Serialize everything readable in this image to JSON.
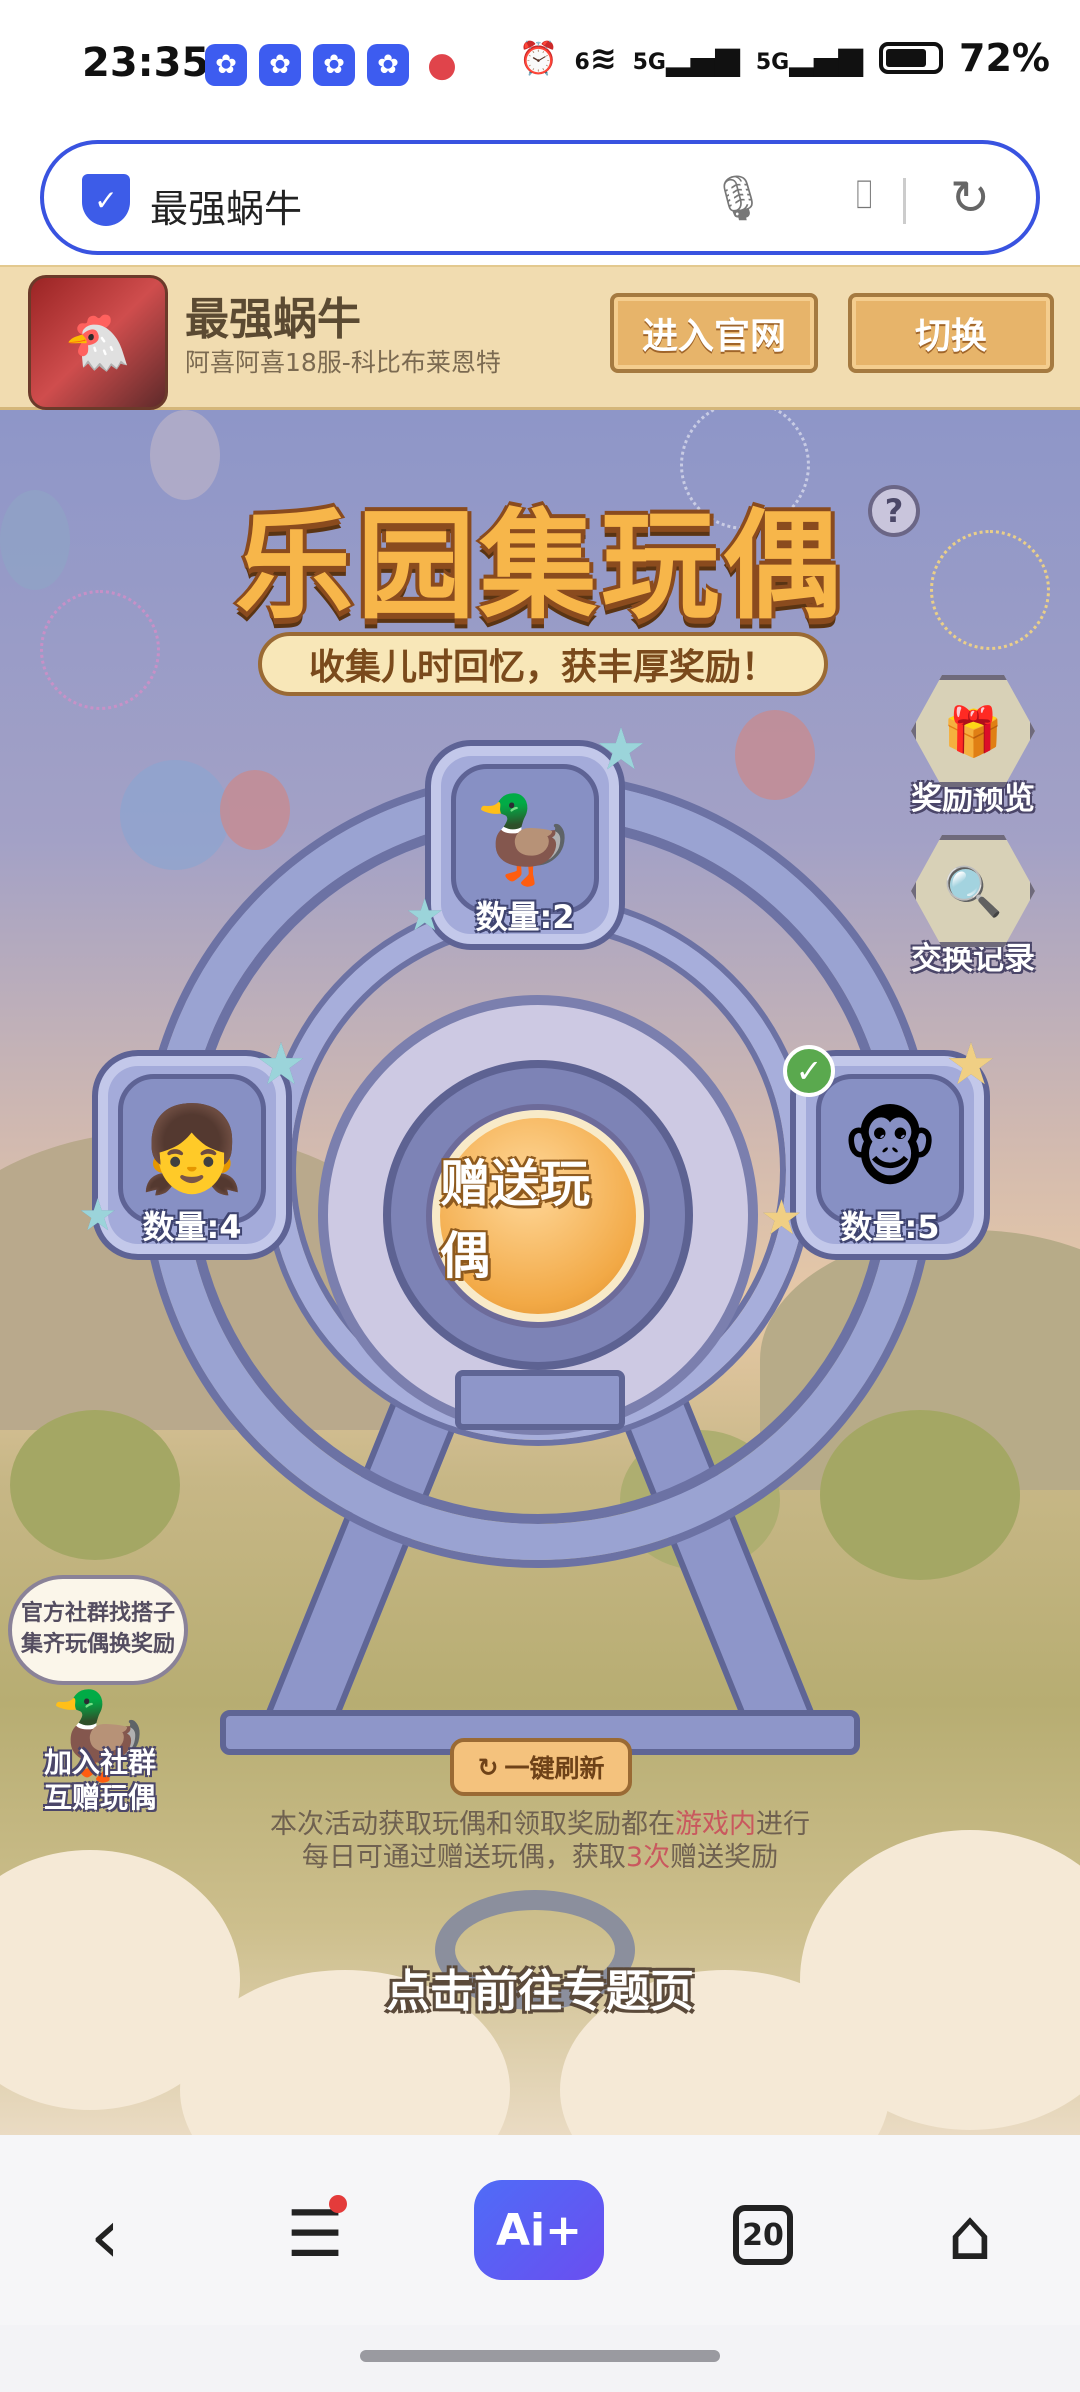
{
  "status_bar": {
    "time": "23:35",
    "notification_icons": [
      "app-icon",
      "app-icon",
      "app-icon",
      "app-icon",
      "map-pin-icon"
    ],
    "signal_1": "5G",
    "signal_2": "5G",
    "wifi_label": "6",
    "battery": "72%"
  },
  "search": {
    "query": "最强蜗牛"
  },
  "game_header": {
    "name": "最强蜗牛",
    "server": "阿喜阿喜18服-科比布莱恩特",
    "site_button": "进入官网",
    "switch_button": "切换"
  },
  "event": {
    "title": "乐园集玩偶",
    "subtitle": "收集儿时回忆，获丰厚奖励！",
    "help": "?",
    "side_buttons": [
      {
        "label": "奖励预览",
        "icon": "gift-icon"
      },
      {
        "label": "交换记录",
        "icon": "magnifier-scroll-icon"
      }
    ],
    "dolls": [
      {
        "count_label": "数量:2",
        "icon": "duck-doll-icon"
      },
      {
        "count_label": "数量:4",
        "icon": "pink-dress-doll-icon"
      },
      {
        "count_label": "数量:5",
        "icon": "monkey-doll-icon",
        "checked": true
      }
    ],
    "gift_button": "赠送玩偶",
    "social_bubble_line1": "官方社群找搭子",
    "social_bubble_line2": "集齐玩偶换奖励",
    "social_label_line1": "加入社群",
    "social_label_line2": "互赠玩偶",
    "refresh_button": "一键刷新",
    "info_line1_a": "本次活动获取玩偶和领取奖励都在",
    "info_line1_hl": "游戏内",
    "info_line1_b": "进行",
    "info_line2_a": "每日可通过赠送玩偶，获取",
    "info_line2_hl": "3次",
    "info_line2_b": "赠送奖励",
    "topic_link": "点击前往专题页"
  },
  "bottom_nav": {
    "back": "‹",
    "menu": "☰",
    "ai": "Ai+",
    "tabs_count": "20",
    "home": "⌂"
  },
  "colors": {
    "accent": "#3953e0",
    "header_bg": "#f1dcb0",
    "gift_button": "#f2a946",
    "highlight": "#c9585e"
  }
}
